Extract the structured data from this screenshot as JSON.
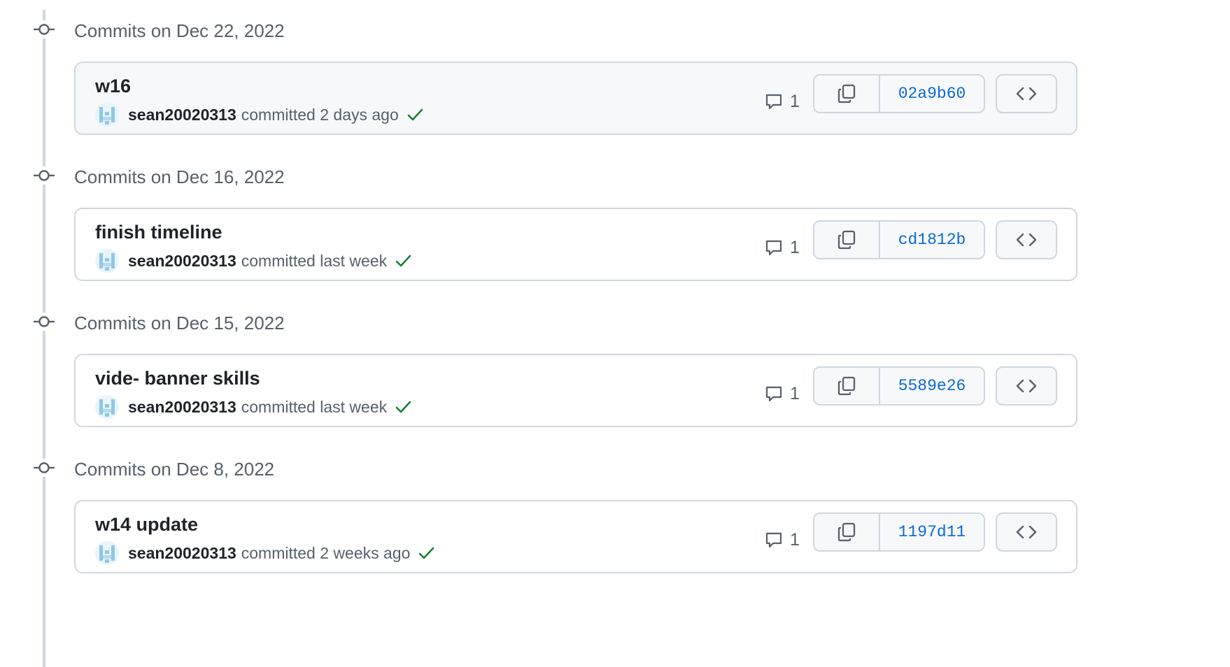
{
  "groups": [
    {
      "date_label": "Commits on Dec 22, 2022",
      "commit": {
        "message": "w16",
        "author": "sean20020313",
        "when": "committed 2 days ago",
        "comments": "1",
        "sha": "02a9b60",
        "highlighted": true
      }
    },
    {
      "date_label": "Commits on Dec 16, 2022",
      "commit": {
        "message": "finish timeline",
        "author": "sean20020313",
        "when": "committed last week",
        "comments": "1",
        "sha": "cd1812b",
        "highlighted": false
      }
    },
    {
      "date_label": "Commits on Dec 15, 2022",
      "commit": {
        "message": "vide- banner skills",
        "author": "sean20020313",
        "when": "committed last week",
        "comments": "1",
        "sha": "5589e26",
        "highlighted": false
      }
    },
    {
      "date_label": "Commits on Dec 8, 2022",
      "commit": {
        "message": "w14 update",
        "author": "sean20020313",
        "when": "committed 2 weeks ago",
        "comments": "1",
        "sha": "1197d11",
        "highlighted": false
      }
    }
  ],
  "icons": {
    "commit_node": "git-commit-icon",
    "comment": "comment-icon",
    "copy": "copy-icon",
    "browse": "code-icon",
    "status": "check-icon"
  },
  "colors": {
    "link": "#0969da",
    "success": "#1a7f37",
    "muted": "#57606a",
    "border": "#d0d7de"
  }
}
